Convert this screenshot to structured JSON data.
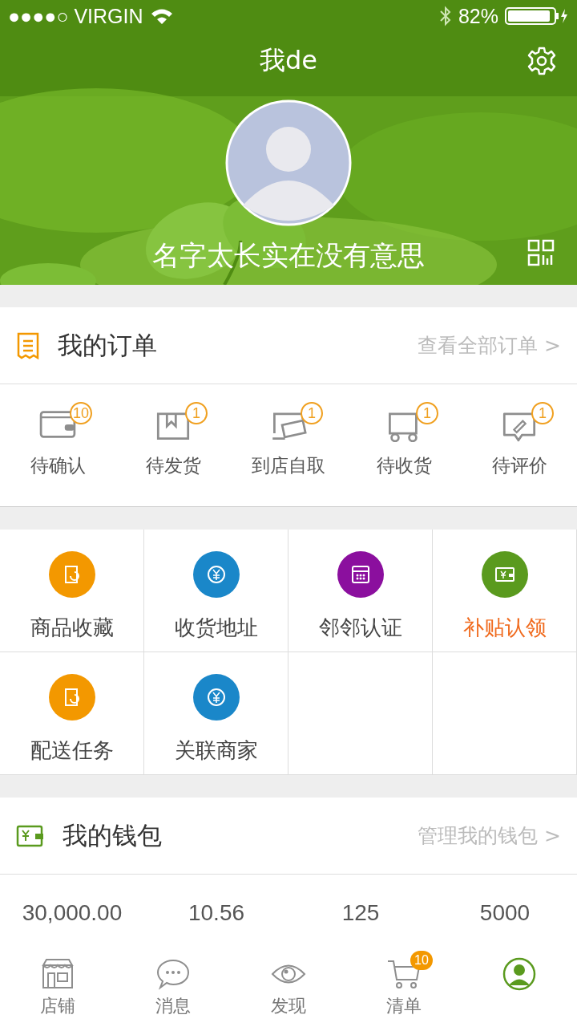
{
  "status_bar": {
    "carrier": "●●●●○ VIRGIN",
    "battery": "82%"
  },
  "header": {
    "title": "我de",
    "username": "名字太长实在没有意思"
  },
  "orders": {
    "title": "我的订单",
    "link": "查看全部订单 >",
    "items": [
      {
        "label": "待确认",
        "badge": "10"
      },
      {
        "label": "待发货",
        "badge": "1"
      },
      {
        "label": "到店自取",
        "badge": "1"
      },
      {
        "label": "待收货",
        "badge": "1"
      },
      {
        "label": "待评价",
        "badge": "1"
      }
    ]
  },
  "services": [
    {
      "label": "商品收藏",
      "color": "#f39800",
      "highlighted": false
    },
    {
      "label": "收货地址",
      "color": "#1a87c9",
      "highlighted": false
    },
    {
      "label": "邻邻认证",
      "color": "#8b0f9e",
      "highlighted": false
    },
    {
      "label": "补贴认领",
      "color": "#5a9a1e",
      "highlighted": true
    },
    {
      "label": "配送任务",
      "color": "#f39800",
      "highlighted": false
    },
    {
      "label": "关联商家",
      "color": "#1a87c9",
      "highlighted": false
    }
  ],
  "wallet": {
    "title": "我的钱包",
    "link": "管理我的钱包 >",
    "values": [
      "30,000.00",
      "10.56",
      "125",
      "5000"
    ]
  },
  "tab_bar": [
    {
      "label": "店铺",
      "selected": false
    },
    {
      "label": "消息",
      "selected": false
    },
    {
      "label": "发现",
      "selected": false
    },
    {
      "label": "清单",
      "selected": false,
      "badge": "10"
    },
    {
      "selected": true
    }
  ]
}
